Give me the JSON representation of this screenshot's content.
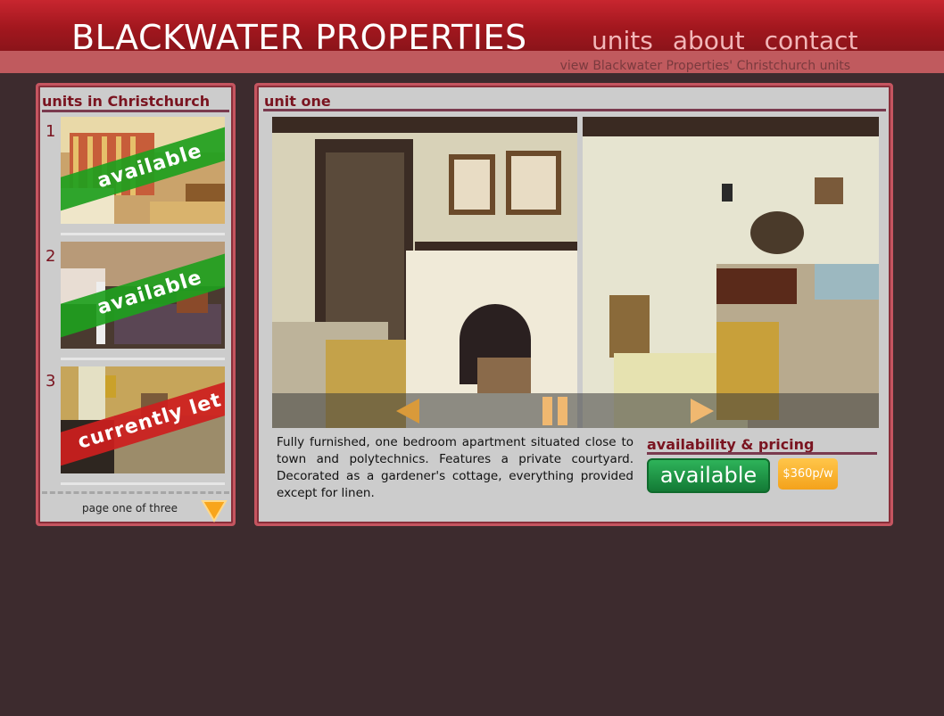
{
  "header": {
    "site_title": "BLACKWATER PROPERTIES",
    "nav": [
      "units",
      "about",
      "contact"
    ],
    "tagline": "view Blackwater Properties' Christchurch units"
  },
  "sidebar": {
    "heading": "units in Christchurch",
    "units": [
      {
        "number": "1",
        "status": "available",
        "status_color": "#1ea01e"
      },
      {
        "number": "2",
        "status": "available",
        "status_color": "#1ea01e"
      },
      {
        "number": "3",
        "status": "currently let",
        "status_color": "#cd1e1e"
      }
    ],
    "pagination": {
      "label": "page one of three"
    }
  },
  "main": {
    "heading": "unit one",
    "description": "Fully furnished, one bedroom apartment situated close to town and polytechnics. Features a private courtyard. Decorated as a gardener's cottage, everything provided except for linen.",
    "availability_heading": "availability & pricing",
    "availability": "available",
    "price": "$360p/w"
  },
  "colors": {
    "header_red": "#a2171e",
    "accent_maroon": "#7a1420",
    "background": "#3d2b2e",
    "panel_border": "#c55560"
  },
  "icons": [
    "previous-arrow-icon",
    "pause-icon",
    "next-arrow-icon",
    "page-down-arrow-icon"
  ]
}
